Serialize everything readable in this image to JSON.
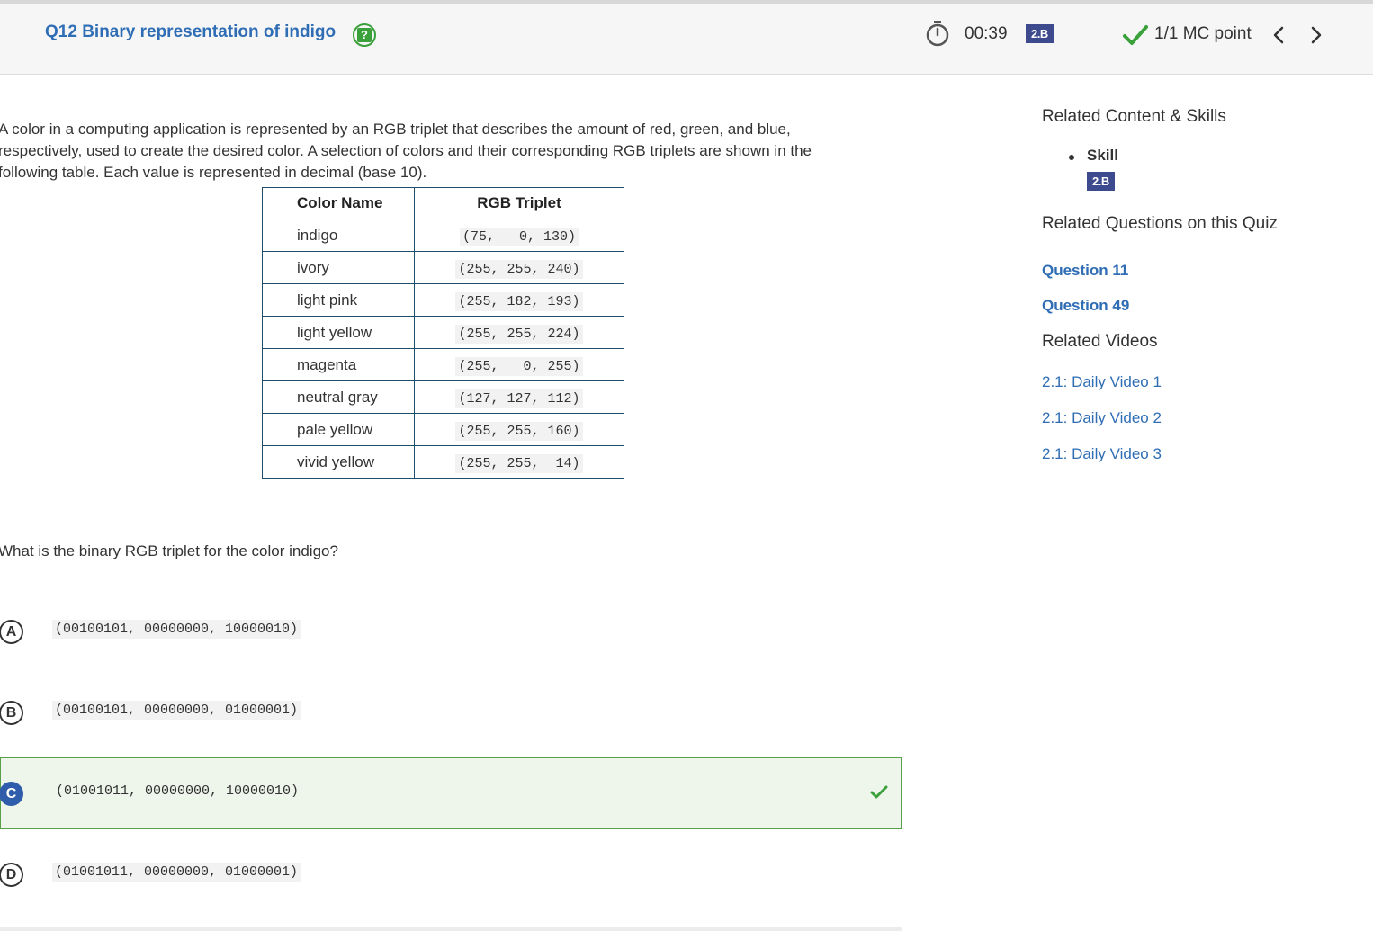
{
  "header": {
    "question_title": "Q12 Binary representation of indigo",
    "help_icon": "help-question-icon",
    "timer": "00:39",
    "skill_badge": "2.B",
    "points": "1/1 MC point",
    "accent_color": "#2f6db5",
    "badge_color": "#3d4a8e",
    "correct_color": "#3aa03a"
  },
  "stem": {
    "text": "A color in a computing application is represented by an RGB triplet that describes the amount of red, green, and blue, respectively, used to create the desired color. A selection of colors and their corresponding RGB triplets are shown in the following table. Each value is represented in decimal (base 10)."
  },
  "table": {
    "headers": [
      "Color Name",
      "RGB Triplet"
    ],
    "rows": [
      {
        "name": "indigo",
        "rgb": "(75,   0, 130)"
      },
      {
        "name": "ivory",
        "rgb": "(255, 255, 240)"
      },
      {
        "name": "light pink",
        "rgb": "(255, 182, 193)"
      },
      {
        "name": "light yellow",
        "rgb": "(255, 255, 224)"
      },
      {
        "name": "magenta",
        "rgb": "(255,   0, 255)"
      },
      {
        "name": "neutral gray",
        "rgb": "(127, 127, 112)"
      },
      {
        "name": "pale yellow",
        "rgb": "(255, 255, 160)"
      },
      {
        "name": "vivid yellow",
        "rgb": "(255, 255,  14)"
      }
    ]
  },
  "question": "What is the binary RGB triplet for the color indigo?",
  "options": [
    {
      "letter": "A",
      "text": "(00100101, 00000000, 10000010)",
      "correct": false
    },
    {
      "letter": "B",
      "text": "(00100101, 00000000, 01000001)",
      "correct": false
    },
    {
      "letter": "C",
      "text": "(01001011, 00000000, 10000010)",
      "correct": true
    },
    {
      "letter": "D",
      "text": "(01001011, 00000000, 01000001)",
      "correct": false
    }
  ],
  "sidebar": {
    "related_content_heading": "Related Content & Skills",
    "skill_label": "Skill",
    "skill_badge": "2.B",
    "related_questions_heading": "Related Questions on this Quiz",
    "related_questions": [
      "Question 11",
      "Question 49"
    ],
    "related_videos_heading": "Related Videos",
    "related_videos": [
      "2.1: Daily Video 1",
      "2.1: Daily Video 2",
      "2.1: Daily Video 3"
    ]
  }
}
